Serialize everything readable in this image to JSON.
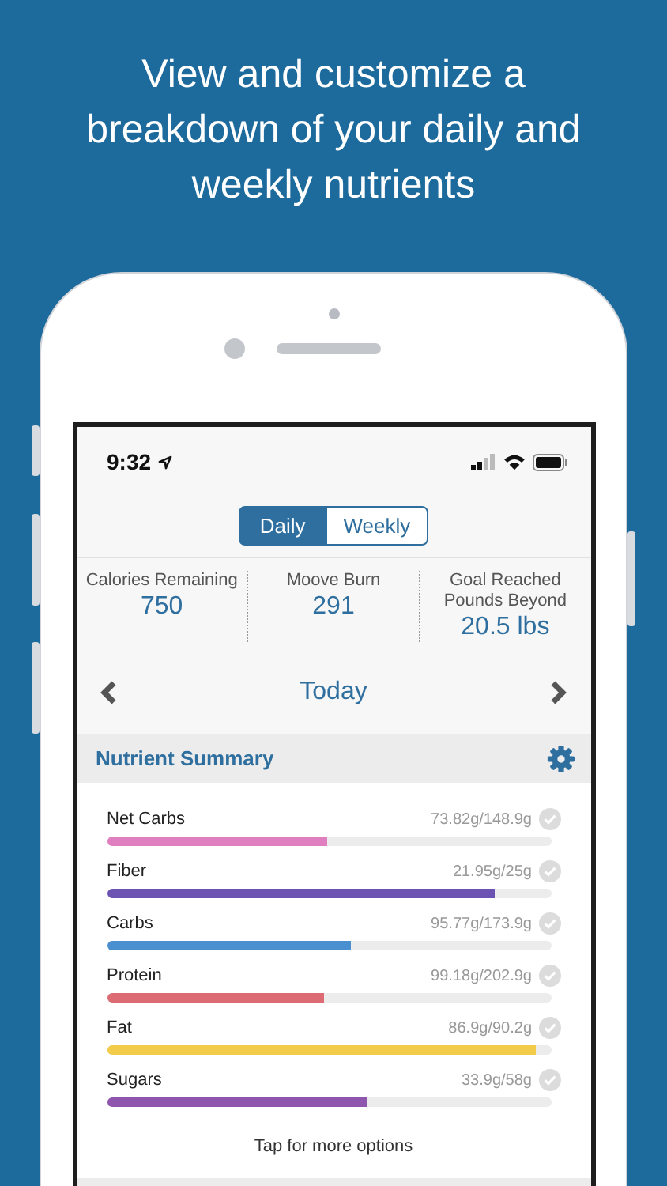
{
  "headline": "View and customize a breakdown of your daily and weekly nutrients",
  "status_bar": {
    "time": "9:32"
  },
  "tabs": [
    {
      "label": "Daily",
      "selected": true
    },
    {
      "label": "Weekly",
      "selected": false
    }
  ],
  "stats": [
    {
      "label": "Calories Remaining",
      "value": "750"
    },
    {
      "label": "Moove Burn",
      "value": "291"
    },
    {
      "label": "Goal Reached Pounds Beyond",
      "value": "20.5 lbs"
    }
  ],
  "date_nav": {
    "label": "Today"
  },
  "nutrient_summary": {
    "title": "Nutrient Summary",
    "nutrients": [
      {
        "name": "Net Carbs",
        "reading": "73.82g/148.9g",
        "level": 0.495,
        "color": "#e07fbf"
      },
      {
        "name": "Fiber",
        "reading": "21.95g/25g",
        "level": 0.875,
        "color": "#6b52b3"
      },
      {
        "name": "Carbs",
        "reading": "95.77g/173.9g",
        "level": 0.55,
        "color": "#4a90d0"
      },
      {
        "name": "Protein",
        "reading": "99.18g/202.9g",
        "level": 0.49,
        "color": "#dd6b73"
      },
      {
        "name": "Fat",
        "reading": "86.9g/90.2g",
        "level": 0.965,
        "color": "#f2cb4a"
      },
      {
        "name": "Sugars",
        "reading": "33.9g/58g",
        "level": 0.585,
        "color": "#8e56ad"
      }
    ],
    "footer": "Tap for more options"
  }
}
